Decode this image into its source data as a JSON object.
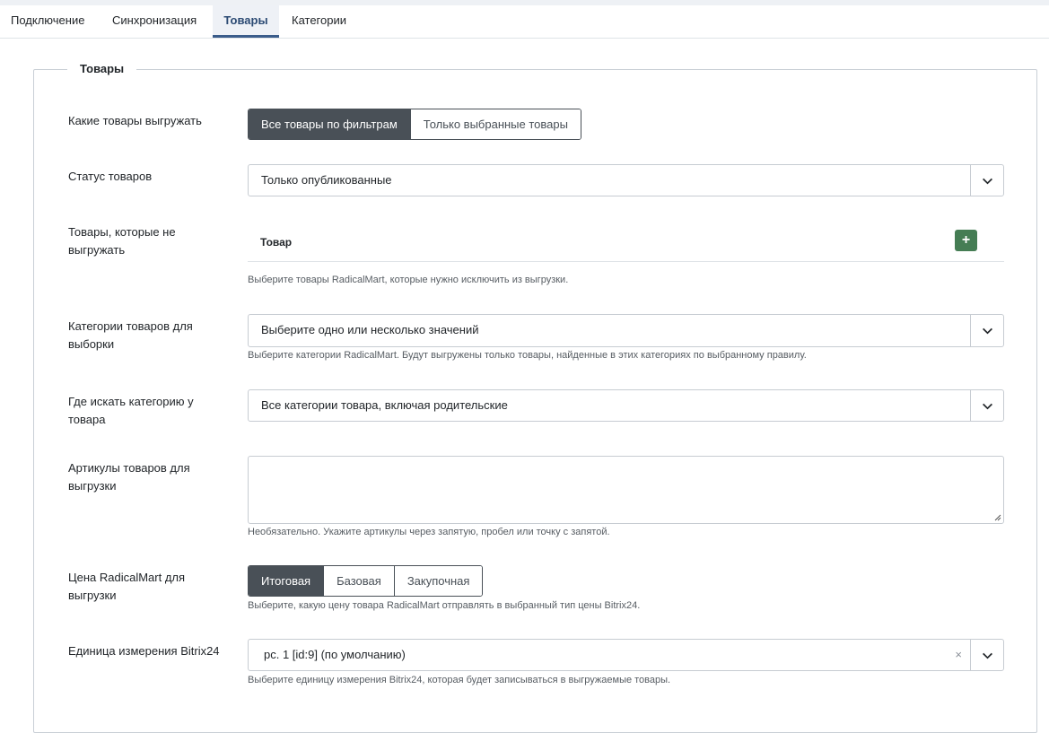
{
  "tabs": [
    {
      "label": "Подключение"
    },
    {
      "label": "Синхронизация"
    },
    {
      "label": "Товары"
    },
    {
      "label": "Категории"
    }
  ],
  "fieldset": {
    "legend": "Товары"
  },
  "fields": {
    "which_products": {
      "label": "Какие товары выгружать",
      "options": [
        "Все товары по фильтрам",
        "Только выбранные товары"
      ]
    },
    "status": {
      "label": "Статус товаров",
      "value": "Только опубликованные"
    },
    "exclude": {
      "label": "Товары, которые не выгружать",
      "column": "Товар",
      "add_label": "+",
      "description": "Выберите товары RadicalMart, которые нужно исключить из выгрузки."
    },
    "categories": {
      "label": "Категории товаров для выборки",
      "placeholder": "Выберите одно или несколько значений",
      "description": "Выберите категории RadicalMart. Будут выгружены только товары, найденные в этих категориях по выбранному правилу."
    },
    "category_search": {
      "label": "Где искать категорию у товара",
      "value": "Все категории товара, включая родительские"
    },
    "skus": {
      "label": "Артикулы товаров для выгрузки",
      "value": "",
      "description": "Необязательно. Укажите артикулы через запятую, пробел или точку с запятой."
    },
    "price": {
      "label": "Цена RadicalMart для выгрузки",
      "options": [
        "Итоговая",
        "Базовая",
        "Закупочная"
      ],
      "description": "Выберите, какую цену товара RadicalMart отправлять в выбранный тип цены Bitrix24."
    },
    "unit": {
      "label": "Единица измерения Bitrix24",
      "value": "pc. 1 [id:9] (по умолчанию)",
      "clear": "×",
      "description": "Выберите единицу измерения Bitrix24, которая будет записываться в выгружаемые товары."
    }
  }
}
